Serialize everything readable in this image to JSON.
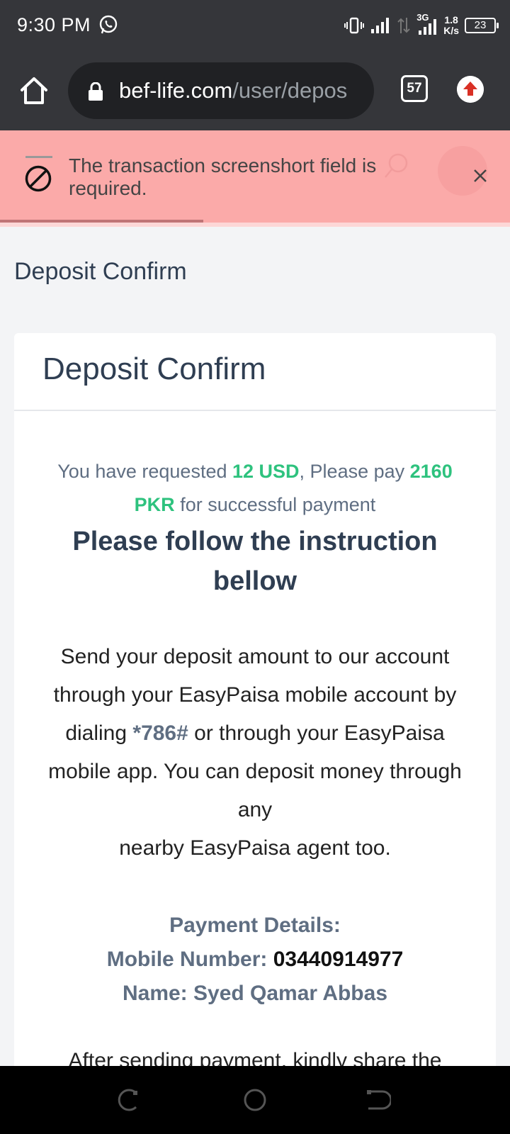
{
  "status_bar": {
    "time": "9:30 PM",
    "net_speed_value": "1.8",
    "net_speed_unit": "K/s",
    "network_type": "3G",
    "battery": "23"
  },
  "browser": {
    "url_domain": "bef-life.com",
    "url_path": "/user/depos",
    "tab_count": "57"
  },
  "alert": {
    "message": "The transaction screenshort field is required."
  },
  "page": {
    "title": "Deposit Confirm",
    "card_title": "Deposit Confirm",
    "request": {
      "prefix": "You have requested ",
      "amount_usd": "12 USD",
      "middle": ", Please pay ",
      "amount_pkr": "2160 PKR",
      "suffix": " for successful payment"
    },
    "instruction_title": "Please follow the instruction bellow",
    "send_text_1": "Send your deposit amount to our account through your EasyPaisa mobile account by dialing ",
    "dial_code": "*786#",
    "send_text_2": " or through your EasyPaisa mobile app. You can deposit money through any",
    "send_text_3": "nearby EasyPaisa agent too.",
    "payment_details_label": "Payment Details:",
    "mobile_label": "Mobile Number: ",
    "mobile_number": "03440914977",
    "name_line": "Name: Syed Qamar Abbas",
    "after_text": "After sending payment, kindly share the"
  },
  "icons": {
    "whatsapp": "whatsapp-icon",
    "home": "home-icon",
    "lock": "lock-icon",
    "update": "update-arrow-icon",
    "alert": "prohibited-icon",
    "close": "close-icon"
  },
  "colors": {
    "alert_bg": "#fbaaa9",
    "accent_green": "#2ec27e",
    "heading": "#2f3e52",
    "toolbar": "#35363a"
  }
}
